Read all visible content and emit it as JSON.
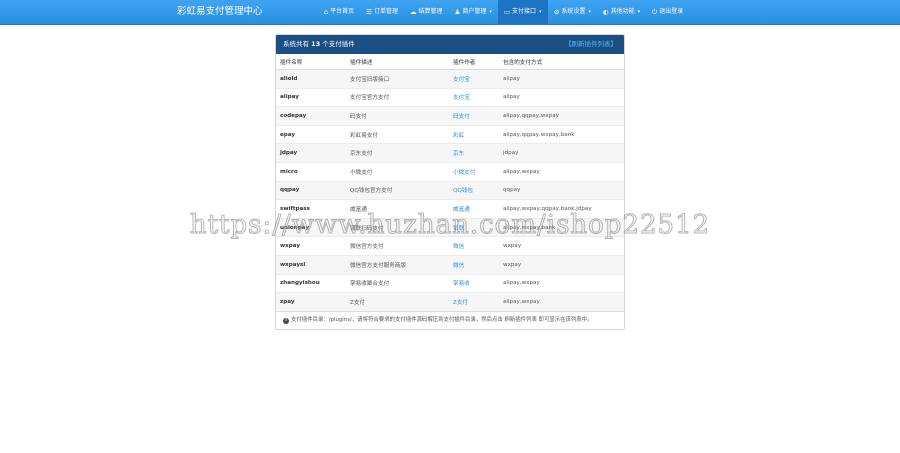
{
  "navbar": {
    "brand": "彩虹易支付管理中心",
    "items": [
      {
        "icon": "⌂",
        "label": "平台首页",
        "caret": false,
        "active": false
      },
      {
        "icon": "☰",
        "label": "订单管理",
        "caret": false,
        "active": false
      },
      {
        "icon": "☁",
        "label": "结算管理",
        "caret": false,
        "active": false
      },
      {
        "icon": "♟",
        "label": "商户管理",
        "caret": true,
        "active": false
      },
      {
        "icon": "▭",
        "label": "支付接口",
        "caret": true,
        "active": true
      },
      {
        "icon": "⚙",
        "label": "系统设置",
        "caret": true,
        "active": false
      },
      {
        "icon": "◐",
        "label": "其他功能",
        "caret": true,
        "active": false
      },
      {
        "icon": "⏻",
        "label": "退出登录",
        "caret": false,
        "active": false
      }
    ]
  },
  "panel": {
    "title_prefix": "系统共有",
    "count": "13",
    "title_suffix": "个支付插件",
    "refresh_label": "【刷新插件列表】",
    "columns": [
      "插件名称",
      "插件描述",
      "插件作者",
      "包含的支付方式"
    ],
    "rows": [
      {
        "name": "aliold",
        "desc": "支付宝旧版接口",
        "author": "支付宝",
        "types": "alipay"
      },
      {
        "name": "alipay",
        "desc": "支付宝官方支付",
        "author": "支付宝",
        "types": "alipay"
      },
      {
        "name": "codepay",
        "desc": "码支付",
        "author": "码支付",
        "types": "alipay,qqpay,wxpay"
      },
      {
        "name": "epay",
        "desc": "彩虹易支付",
        "author": "彩虹",
        "types": "alipay,qqpay,wxpay,bank"
      },
      {
        "name": "jdpay",
        "desc": "京东支付",
        "author": "京东",
        "types": "jdpay"
      },
      {
        "name": "micro",
        "desc": "小微支付",
        "author": "小微支付",
        "types": "alipay,wxpay"
      },
      {
        "name": "qqpay",
        "desc": "QQ钱包官方支付",
        "author": "QQ钱包",
        "types": "qqpay"
      },
      {
        "name": "swiftpass",
        "desc": "威富通",
        "author": "威富通",
        "types": "alipay,wxpay,qqpay,bank,jdpay"
      },
      {
        "name": "unionpay",
        "desc": "银联扫码支付",
        "author": "银联",
        "types": "alipay,wxpay,bank"
      },
      {
        "name": "wxpay",
        "desc": "微信官方支付",
        "author": "微信",
        "types": "wxpay"
      },
      {
        "name": "wxpaysl",
        "desc": "微信官方支付服务商版",
        "author": "微信",
        "types": "wxpay"
      },
      {
        "name": "zhangyishou",
        "desc": "掌易收聚合支付",
        "author": "掌易收",
        "types": "alipay,wxpay"
      },
      {
        "name": "zpay",
        "desc": "Z支付",
        "author": "Z支付",
        "types": "alipay,wxpay"
      }
    ],
    "note": "支付插件目录：/plugins/，请将符合要求的支付插件源码解压到支付插件目录，然后点击 刷新插件列表 即可显示在该列表中。"
  },
  "watermark": "https://www.huzhan.com/ishop22512"
}
